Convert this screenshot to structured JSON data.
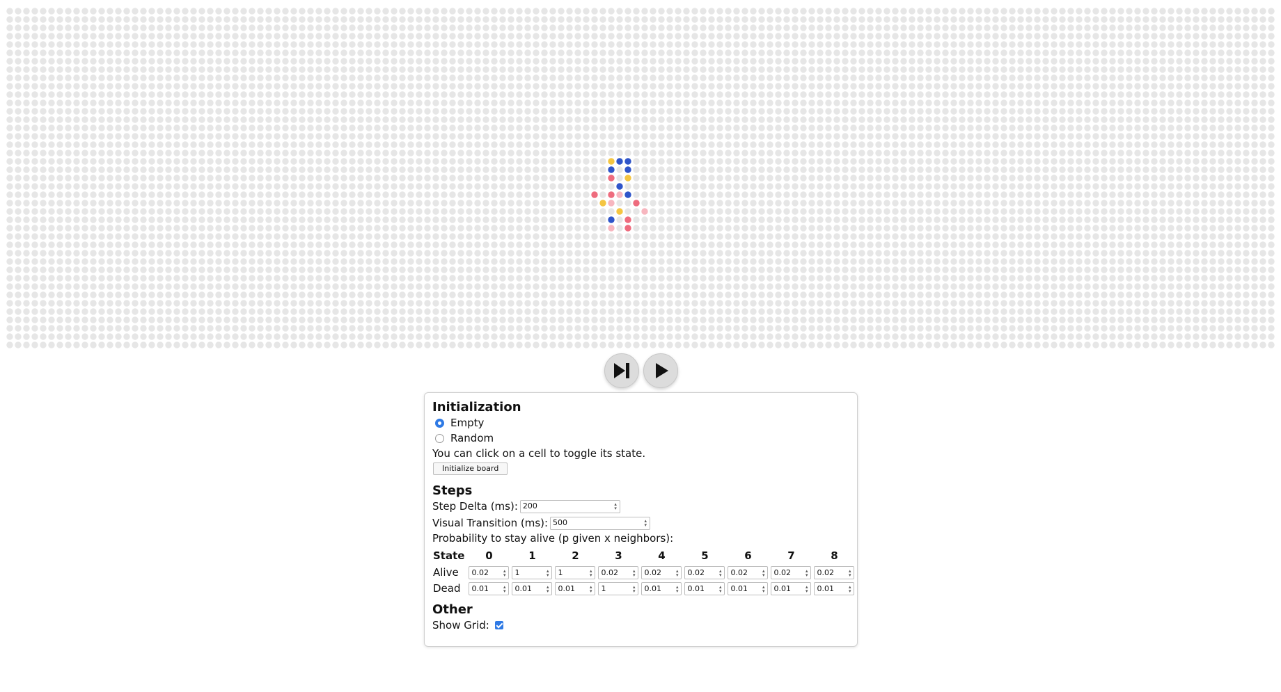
{
  "board": {
    "grid_color": "#e6e6e6",
    "state_colors": {
      "blue": "#2f55c9",
      "yellow": "#f4c542",
      "red": "#ee6c7e",
      "pink": "#f7b6bf"
    },
    "live_cells": [
      {
        "row": 18,
        "col": 72,
        "state": "yellow"
      },
      {
        "row": 18,
        "col": 73,
        "state": "blue"
      },
      {
        "row": 18,
        "col": 74,
        "state": "blue"
      },
      {
        "row": 19,
        "col": 72,
        "state": "blue"
      },
      {
        "row": 19,
        "col": 74,
        "state": "blue"
      },
      {
        "row": 20,
        "col": 72,
        "state": "red"
      },
      {
        "row": 20,
        "col": 74,
        "state": "yellow"
      },
      {
        "row": 21,
        "col": 73,
        "state": "blue"
      },
      {
        "row": 22,
        "col": 70,
        "state": "red"
      },
      {
        "row": 22,
        "col": 72,
        "state": "red"
      },
      {
        "row": 22,
        "col": 73,
        "state": "pink"
      },
      {
        "row": 22,
        "col": 74,
        "state": "blue"
      },
      {
        "row": 23,
        "col": 71,
        "state": "yellow"
      },
      {
        "row": 23,
        "col": 72,
        "state": "pink"
      },
      {
        "row": 23,
        "col": 75,
        "state": "red"
      },
      {
        "row": 24,
        "col": 73,
        "state": "yellow"
      },
      {
        "row": 24,
        "col": 76,
        "state": "pink"
      },
      {
        "row": 25,
        "col": 72,
        "state": "blue"
      },
      {
        "row": 25,
        "col": 74,
        "state": "red"
      },
      {
        "row": 26,
        "col": 72,
        "state": "pink"
      },
      {
        "row": 26,
        "col": 74,
        "state": "red"
      }
    ]
  },
  "controls": {
    "step_icon": "skip-forward-icon",
    "play_icon": "play-icon"
  },
  "panel": {
    "init_title": "Initialization",
    "options": [
      {
        "label": "Empty",
        "checked": true
      },
      {
        "label": "Random",
        "checked": false
      }
    ],
    "hint": "You can click on a cell to toggle its state.",
    "init_button": "Initialize board",
    "steps_title": "Steps",
    "step_delta_label": "Step Delta (ms):",
    "step_delta_value": "200",
    "visual_transition_label": "Visual Transition (ms):",
    "visual_transition_value": "500",
    "prob_label": "Probability to stay alive (p given x neighbors):",
    "table": {
      "state_header": "State",
      "headers": [
        "0",
        "1",
        "2",
        "3",
        "4",
        "5",
        "6",
        "7",
        "8"
      ],
      "rows": [
        {
          "label": "Alive",
          "values": [
            "0.02",
            "1",
            "1",
            "0.02",
            "0.02",
            "0.02",
            "0.02",
            "0.02",
            "0.02"
          ]
        },
        {
          "label": "Dead",
          "values": [
            "0.01",
            "0.01",
            "0.01",
            "1",
            "0.01",
            "0.01",
            "0.01",
            "0.01",
            "0.01"
          ]
        }
      ]
    },
    "other_title": "Other",
    "show_grid_label": "Show Grid:",
    "show_grid_checked": true
  }
}
